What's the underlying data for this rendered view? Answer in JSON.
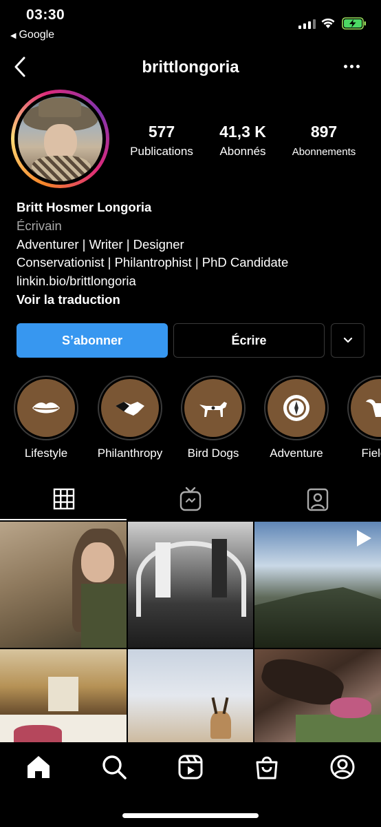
{
  "status_bar": {
    "time": "03:30",
    "back_app_label": "Google"
  },
  "header": {
    "username": "brittlongoria"
  },
  "stats": {
    "posts_count": "577",
    "posts_label": "Publications",
    "followers_count": "41,3 K",
    "followers_label": "Abonnés",
    "following_count": "897",
    "following_label": "Abonnements"
  },
  "bio": {
    "name": "Britt Hosmer Longoria",
    "category": "Écrivain",
    "line1": "Adventurer | Writer | Designer",
    "line2": "Conservationist | Philantrophist | PhD Candidate",
    "link": "linkin.bio/brittlongoria",
    "translate": "Voir la traduction"
  },
  "actions": {
    "follow_label": "S’abonner",
    "message_label": "Écrire"
  },
  "highlights": [
    {
      "label": "Lifestyle",
      "icon": "lips-icon"
    },
    {
      "label": "Philanthropy",
      "icon": "handshake-icon"
    },
    {
      "label": "Bird Dogs",
      "icon": "dog-icon"
    },
    {
      "label": "Adventure",
      "icon": "compass-icon"
    },
    {
      "label": "Field P",
      "icon": "buffalo-skull-icon"
    }
  ],
  "tabs": [
    "grid-icon",
    "igtv-icon",
    "tagged-icon"
  ],
  "bottom_nav": [
    "home-icon",
    "search-icon",
    "reels-icon",
    "shop-icon",
    "profile-icon"
  ],
  "colors": {
    "follow_button": "#3797f0",
    "highlight_fill": "#7a5634",
    "background": "#000000"
  }
}
